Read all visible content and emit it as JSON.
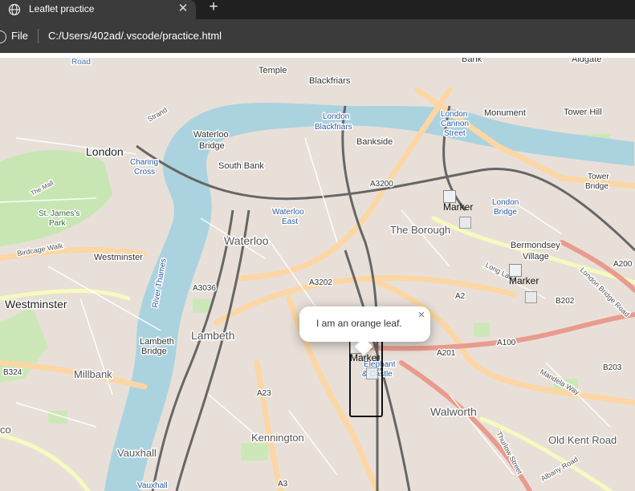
{
  "browser": {
    "tab_title": "Leaflet practice",
    "tab_close": "✕",
    "new_tab": "+",
    "scheme_label": "File",
    "url": "C:/Users/402ad/.vscode/practice.html"
  },
  "map": {
    "tile_source": "OpenStreetMap",
    "popup": {
      "text": "I am an orange leaf.",
      "close": "×"
    },
    "markers": [
      {
        "label": "Marker"
      },
      {
        "label": "Marker"
      },
      {
        "label": "Marker"
      }
    ],
    "labels": {
      "road_top": "Road",
      "temple": "Temple",
      "blackfriars": "Blackfriars",
      "bank": "Bank",
      "aldgate": "Aldgate",
      "strand": "Strand",
      "london_blackfriars": [
        "London",
        "Blackfriars"
      ],
      "monument": "Monument",
      "tower_hill": "Tower Hill",
      "london_cannon": [
        "London",
        "Cannon",
        "Street"
      ],
      "waterloo_bridge": [
        "Waterloo",
        "Bridge"
      ],
      "london": "London",
      "bankside": "Bankside",
      "charing_cross": [
        "Charing",
        "Cross"
      ],
      "south_bank": "South Bank",
      "a3200": "A3200",
      "tower_bridge": [
        "Tower",
        "Bridge"
      ],
      "the_mall": "The Mall",
      "st_james_park": [
        "St. James's",
        "Park"
      ],
      "waterloo_east": [
        "Waterloo",
        "East"
      ],
      "london_bridge": [
        "London",
        "Bridge"
      ],
      "the_borough": "The Borough",
      "waterloo": "Waterloo",
      "bermondsey_village": [
        "Bermondsey",
        "Village"
      ],
      "birdcage_walk": "Birdcage Walk",
      "westminster_small": "Westminster",
      "a200": "A200",
      "long_lane": "Long Lane",
      "london_bridge_road": "London Bridge Road",
      "a3036": "A3036",
      "a3202": "A3202",
      "river_thames": "River Thames",
      "westminster": "Westminster",
      "a2": "A2",
      "b202": "B202",
      "lambeth": "Lambeth",
      "lambeth_bridge": [
        "Lambeth",
        "Bridge"
      ],
      "a201": "A201",
      "a100": "A100",
      "b324": "B324",
      "millbank": "Millbank",
      "elephant_castle": [
        "Elephant",
        "& Castle"
      ],
      "b203": "B203",
      "mandela_way": "Mandela Way",
      "a23": "A23",
      "walworth": "Walworth",
      "co": "co",
      "kennington": "Kennington",
      "old_kent_road": "Old Kent Road",
      "thurlow_street": "Thurlow Street",
      "albany_road": "Albany Road",
      "vauxhall": "Vauxhall",
      "vauxhall_station": "Vauxhall",
      "a3": "A3"
    }
  }
}
